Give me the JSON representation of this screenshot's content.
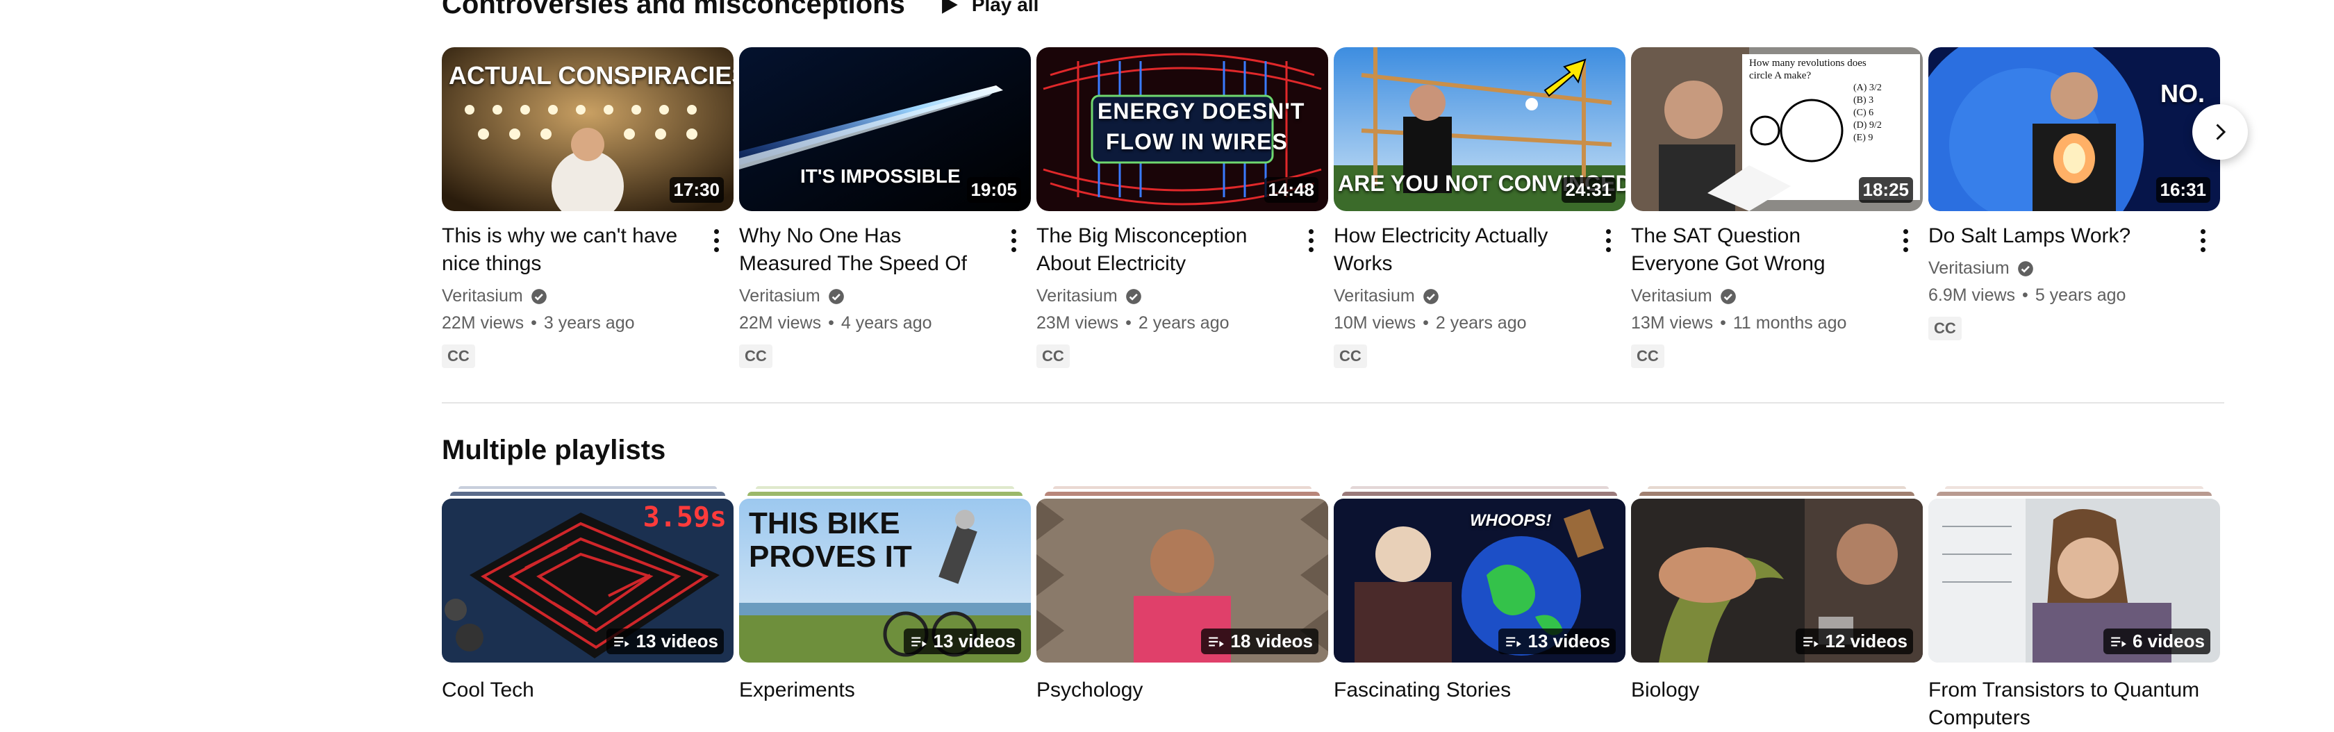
{
  "section1": {
    "title": "Controversies and misconceptions",
    "play_all": "Play all",
    "videos": [
      {
        "thumb_text": "ACTUAL CONSPIRACIES",
        "duration": "17:30",
        "title": "This is why we can't have nice things",
        "channel": "Veritasium",
        "views": "22M views",
        "age": "3 years ago",
        "cc": "CC"
      },
      {
        "thumb_text": "IT'S IMPOSSIBLE",
        "duration": "19:05",
        "title": "Why No One Has Measured The Speed Of Light",
        "channel": "Veritasium",
        "views": "22M views",
        "age": "4 years ago",
        "cc": "CC"
      },
      {
        "thumb_text_1": "ENERGY DOESN'T",
        "thumb_text_2": "FLOW IN WIRES",
        "duration": "14:48",
        "title": "The Big Misconception About Electricity",
        "channel": "Veritasium",
        "views": "23M views",
        "age": "2 years ago",
        "cc": "CC"
      },
      {
        "thumb_text": "ARE YOU NOT CONVINCED?",
        "duration": "24:31",
        "title": "How Electricity Actually Works",
        "channel": "Veritasium",
        "views": "10M views",
        "age": "2 years ago",
        "cc": "CC"
      },
      {
        "thumb_lines": [
          "How many revolutions does",
          "circle A make?",
          "(A) 3/2",
          "(B) 3",
          "(C) 6",
          "(D) 9/2",
          "(E) 9"
        ],
        "duration": "18:25",
        "title": "The SAT Question Everyone Got Wrong",
        "channel": "Veritasium",
        "views": "13M views",
        "age": "11 months ago",
        "cc": "CC"
      },
      {
        "thumb_text": "NO.",
        "duration": "16:31",
        "title": "Do Salt Lamps Work?",
        "channel": "Veritasium",
        "views": "6.9M views",
        "age": "5 years ago",
        "cc": "CC"
      }
    ]
  },
  "section2": {
    "title": "Multiple playlists",
    "playlists": [
      {
        "thumb_text": "3.59s",
        "count": "13 videos",
        "title": "Cool Tech",
        "stack_color": "#5a6b8a"
      },
      {
        "thumb_text_1": "THIS BIKE",
        "thumb_text_2": "PROVES IT",
        "count": "13 videos",
        "title": "Experiments",
        "stack_color": "#9bb86a"
      },
      {
        "count": "18 videos",
        "title": "Psychology",
        "stack_color": "#b8867a"
      },
      {
        "thumb_text": "WHOOPS!",
        "count": "13 videos",
        "title": "Fascinating Stories",
        "stack_color": "#9a7a7a"
      },
      {
        "count": "12 videos",
        "title": "Biology",
        "stack_color": "#a08070"
      },
      {
        "count": "6 videos",
        "title": "From Transistors to Quantum Computers",
        "stack_color": "#b89a90"
      }
    ]
  },
  "icons": {
    "play": "play-icon",
    "verified": "verified-check-icon",
    "more": "more-vert-icon",
    "next": "chevron-right-icon",
    "playlist": "playlist-icon"
  }
}
